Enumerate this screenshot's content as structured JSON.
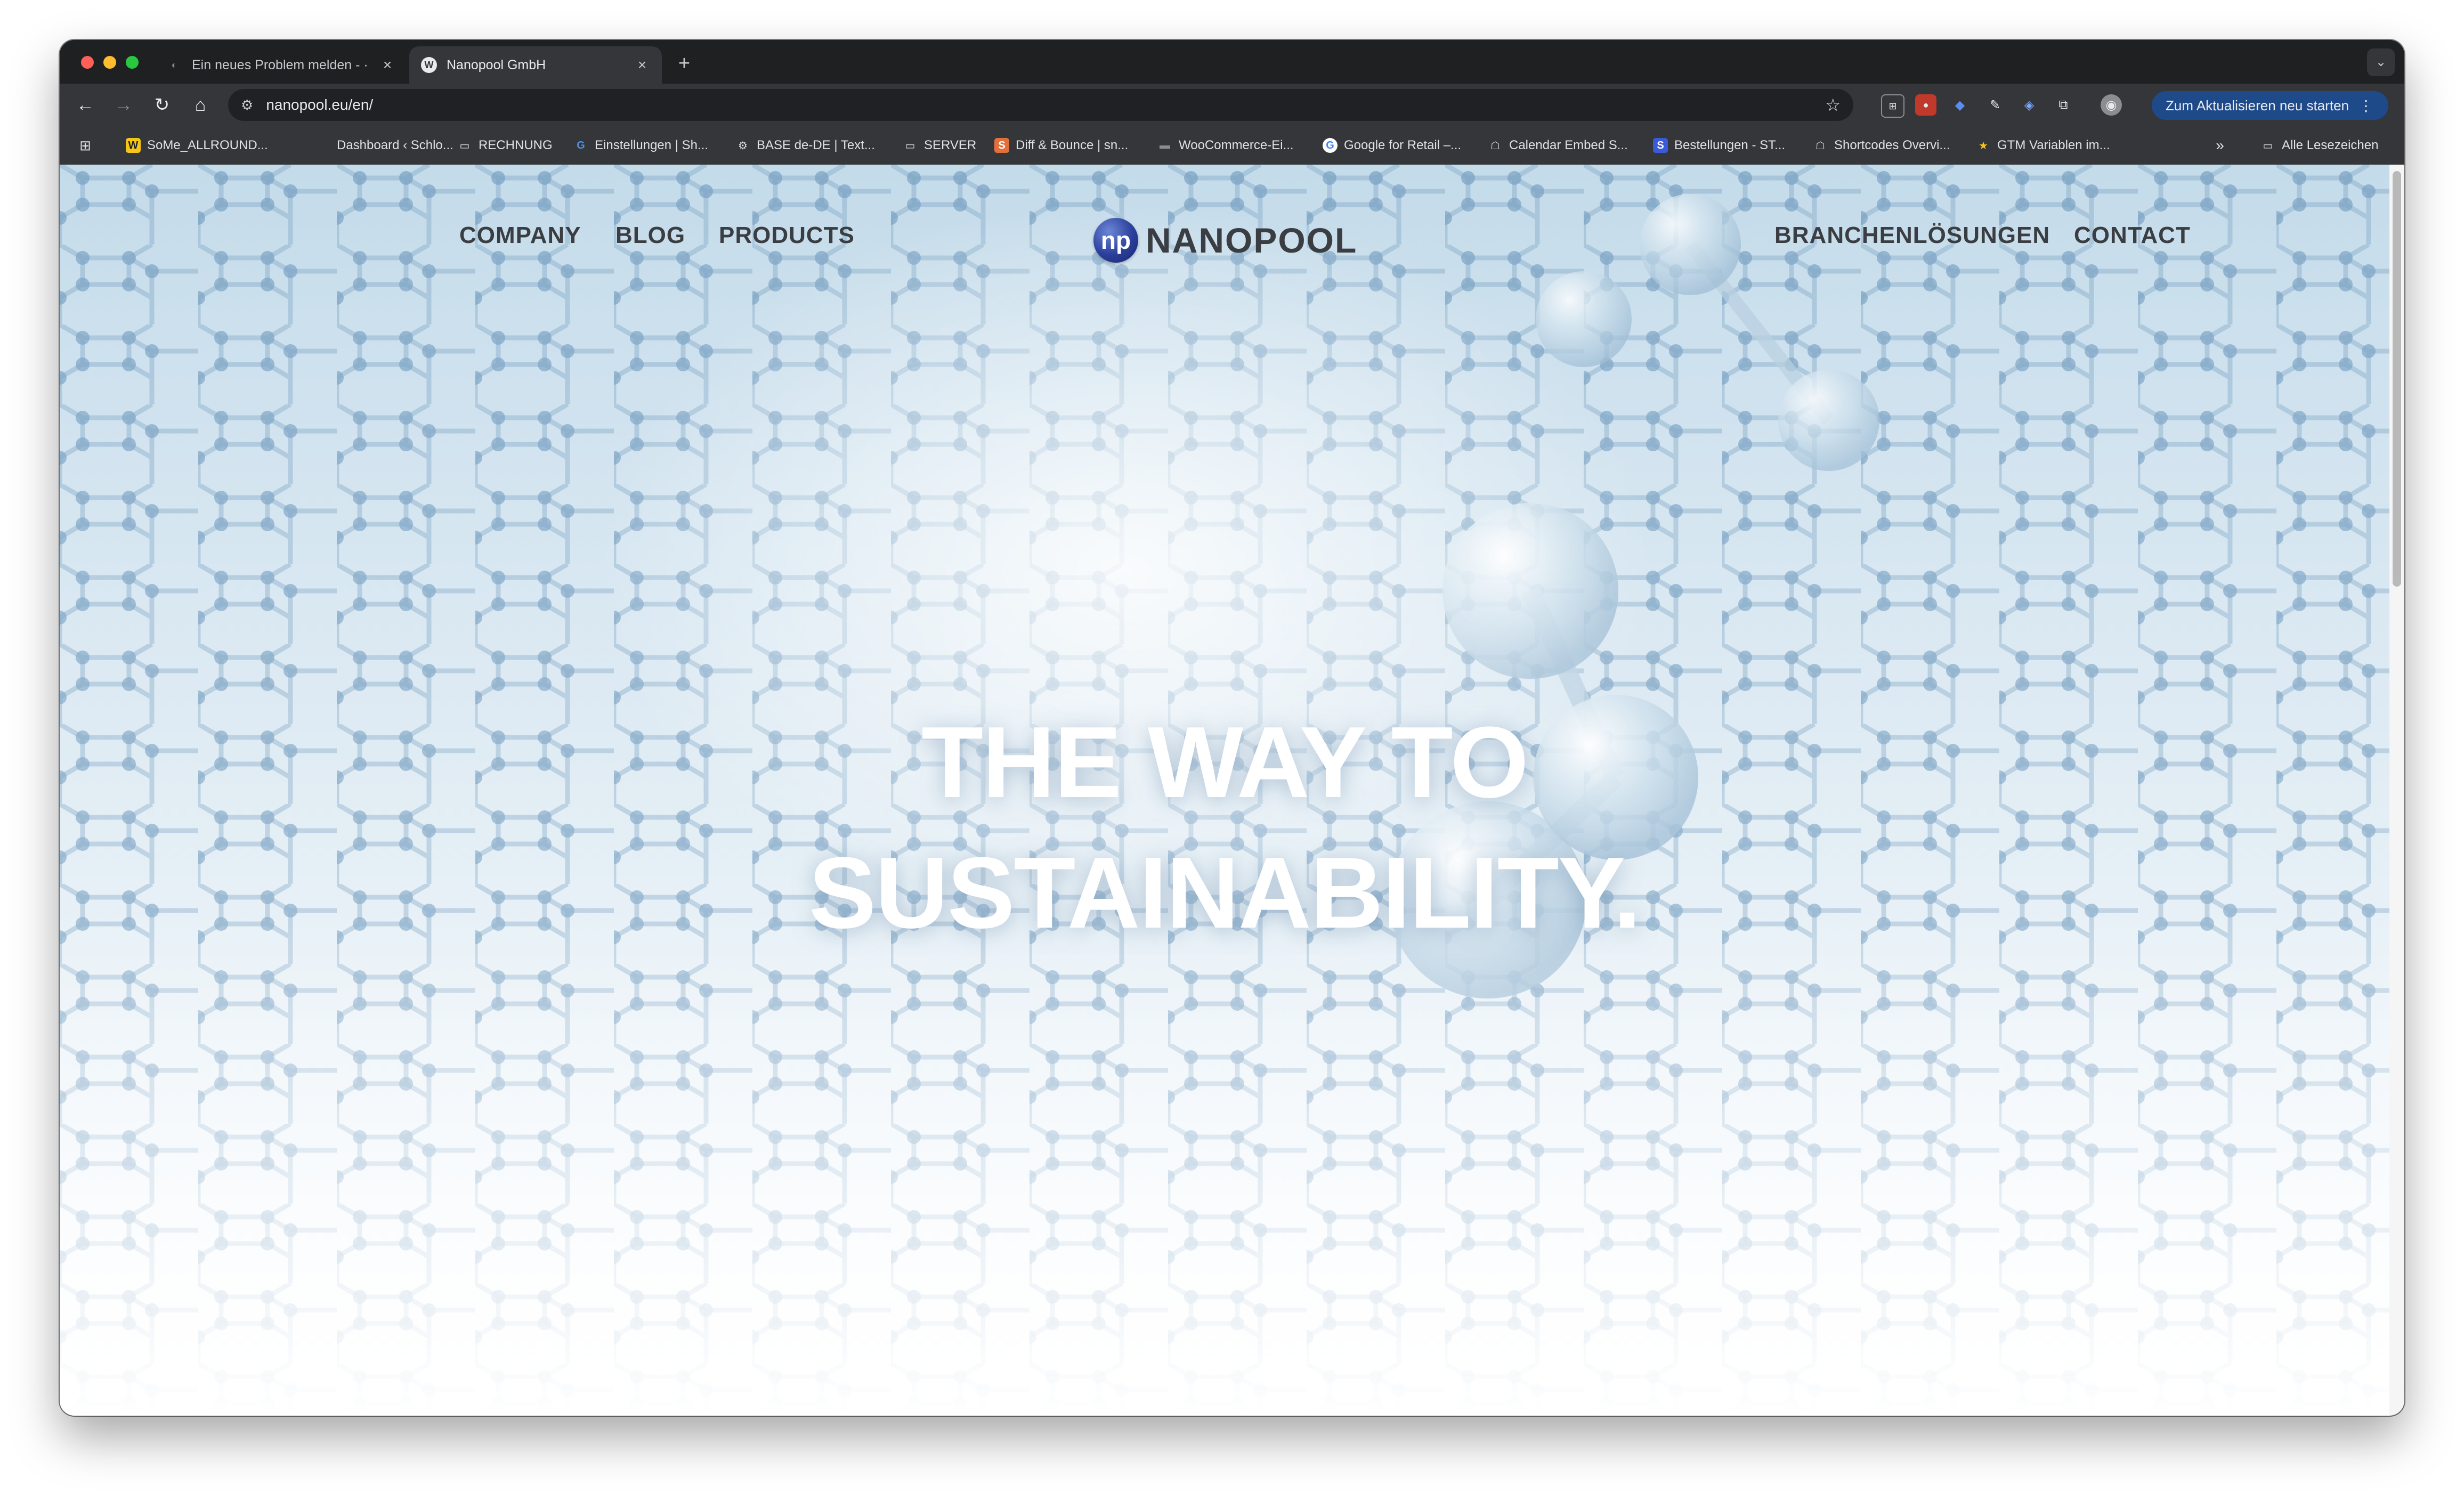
{
  "browser": {
    "tabs": [
      {
        "title": "Ein neues Problem melden - ·",
        "active": false
      },
      {
        "title": "Nanopool GmbH",
        "active": true
      }
    ],
    "new_tab_label": "+",
    "address": "nanopool.eu/en/",
    "update_button_label": "Zum Aktualisieren neu starten",
    "bookmarks": [
      "SoMe_ALLROUND...",
      "Dashboard ‹ Schlo...",
      "RECHNUNG",
      "Einstellungen | Sh...",
      "BASE de-DE | Text...",
      "SERVER",
      "Diff & Bounce | sn...",
      "WooCommerce-Ei...",
      "Google for Retail –...",
      "Calendar Embed S...",
      "Bestellungen - ST...",
      "Shortcodes Overvi...",
      "GTM Variablen im..."
    ],
    "all_bookmarks_label": "Alle Lesezeichen"
  },
  "site": {
    "nav_left": [
      "COMPANY",
      "BLOG",
      "PRODUCTS"
    ],
    "nav_right": [
      "BRANCHENLÖSUNGEN",
      "CONTACT"
    ],
    "logo_mark": "np",
    "logo_text": "NANOPOOL",
    "hero_line_1": "THE WAY TO",
    "hero_line_2": "SUSTAINABILITY."
  },
  "colors": {
    "brand_blue": "#2b3f9a",
    "nav_text": "#3a3d42",
    "hero_text": "#ffffff"
  }
}
